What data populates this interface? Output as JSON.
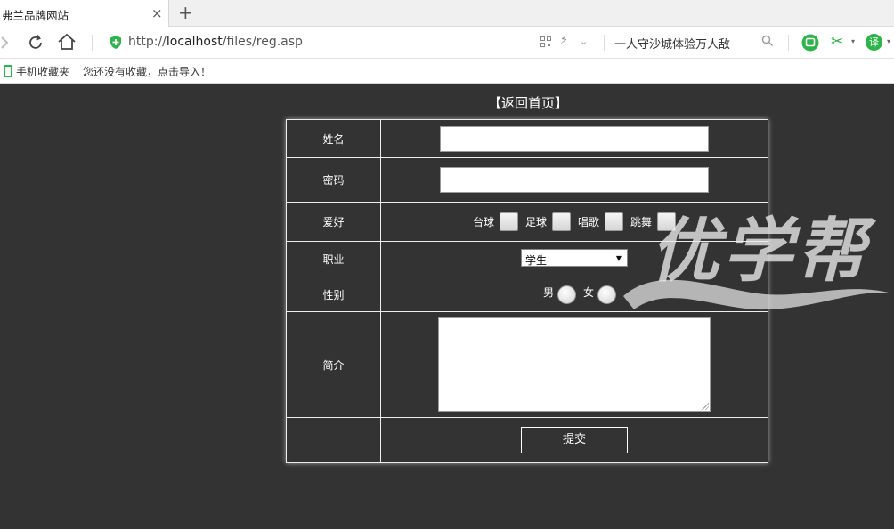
{
  "browser": {
    "tab_title": "弗兰品牌网站",
    "tab_close": "×",
    "new_tab": "+",
    "url_prefix": "http://",
    "url_host": "localhost",
    "url_path": "/files/reg.asp",
    "search_text": "一人守沙城体验万人敌",
    "translate_label": "译",
    "accent_color": "#2db44a"
  },
  "bookmarks": {
    "mobile_label": "手机收藏夹",
    "empty_hint": "您还没有收藏，点击导入！"
  },
  "page": {
    "back_link": "【返回首页】",
    "background": "#333333"
  },
  "form": {
    "name_label": "姓名",
    "password_label": "密码",
    "hobby_label": "爱好",
    "hobbies": [
      "台球",
      "足球",
      "唱歌",
      "跳舞"
    ],
    "job_label": "职业",
    "job_selected": "学生",
    "gender_label": "性别",
    "genders": [
      "男",
      "女"
    ],
    "intro_label": "简介",
    "submit_label": "提交"
  },
  "watermark": {
    "text": "优学帮"
  }
}
